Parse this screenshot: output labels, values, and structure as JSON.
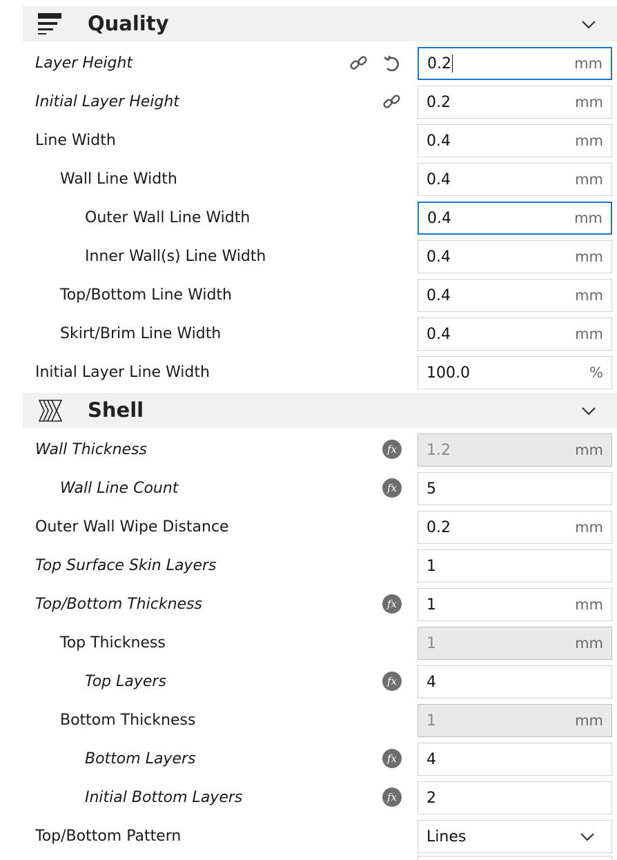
{
  "sections": {
    "quality": {
      "title": "Quality",
      "icon": "quality-lines-icon",
      "rows": [
        {
          "label": "Layer Height",
          "value": "0.2",
          "unit": "mm",
          "italic": true
        },
        {
          "label": "Initial Layer Height",
          "value": "0.2",
          "unit": "mm",
          "italic": true
        },
        {
          "label": "Line Width",
          "value": "0.4",
          "unit": "mm",
          "italic": false
        },
        {
          "label": "Wall Line Width",
          "value": "0.4",
          "unit": "mm",
          "italic": false
        },
        {
          "label": "Outer Wall Line Width",
          "value": "0.4",
          "unit": "mm",
          "italic": false
        },
        {
          "label": "Inner Wall(s) Line Width",
          "value": "0.4",
          "unit": "mm",
          "italic": false
        },
        {
          "label": "Top/Bottom Line Width",
          "value": "0.4",
          "unit": "mm",
          "italic": false
        },
        {
          "label": "Skirt/Brim Line Width",
          "value": "0.4",
          "unit": "mm",
          "italic": false
        },
        {
          "label": "Initial Layer Line Width",
          "value": "100.0",
          "unit": "%",
          "italic": false
        }
      ]
    },
    "shell": {
      "title": "Shell",
      "icon": "shell-walls-icon",
      "rows": [
        {
          "label": "Wall Thickness",
          "value": "1.2",
          "unit": "mm",
          "italic": true,
          "disabled": true
        },
        {
          "label": "Wall Line Count",
          "value": "5",
          "unit": "",
          "italic": true
        },
        {
          "label": "Outer Wall Wipe Distance",
          "value": "0.2",
          "unit": "mm",
          "italic": false
        },
        {
          "label": "Top Surface Skin Layers",
          "value": "1",
          "unit": "",
          "italic": true
        },
        {
          "label": "Top/Bottom Thickness",
          "value": "1",
          "unit": "mm",
          "italic": true
        },
        {
          "label": "Top Thickness",
          "value": "1",
          "unit": "mm",
          "italic": false,
          "disabled": true
        },
        {
          "label": "Top Layers",
          "value": "4",
          "unit": "",
          "italic": true
        },
        {
          "label": "Bottom Thickness",
          "value": "1",
          "unit": "mm",
          "italic": false,
          "disabled": true
        },
        {
          "label": "Bottom Layers",
          "value": "4",
          "unit": "",
          "italic": true
        },
        {
          "label": "Initial Bottom Layers",
          "value": "2",
          "unit": "",
          "italic": true
        },
        {
          "label": "Top/Bottom Pattern",
          "value": "Lines",
          "unit": "",
          "italic": false
        }
      ]
    }
  },
  "icons": {
    "link": "link-icon",
    "reset": "reset-icon",
    "function": "function-icon",
    "collapse": "chevron-down-icon",
    "fx_text": "fx"
  },
  "colors": {
    "accent": "#1e74c9",
    "header_bg": "#f1f1f1",
    "disabled_bg": "#e9e9e9",
    "icon_gray": "#6e6e6e"
  }
}
